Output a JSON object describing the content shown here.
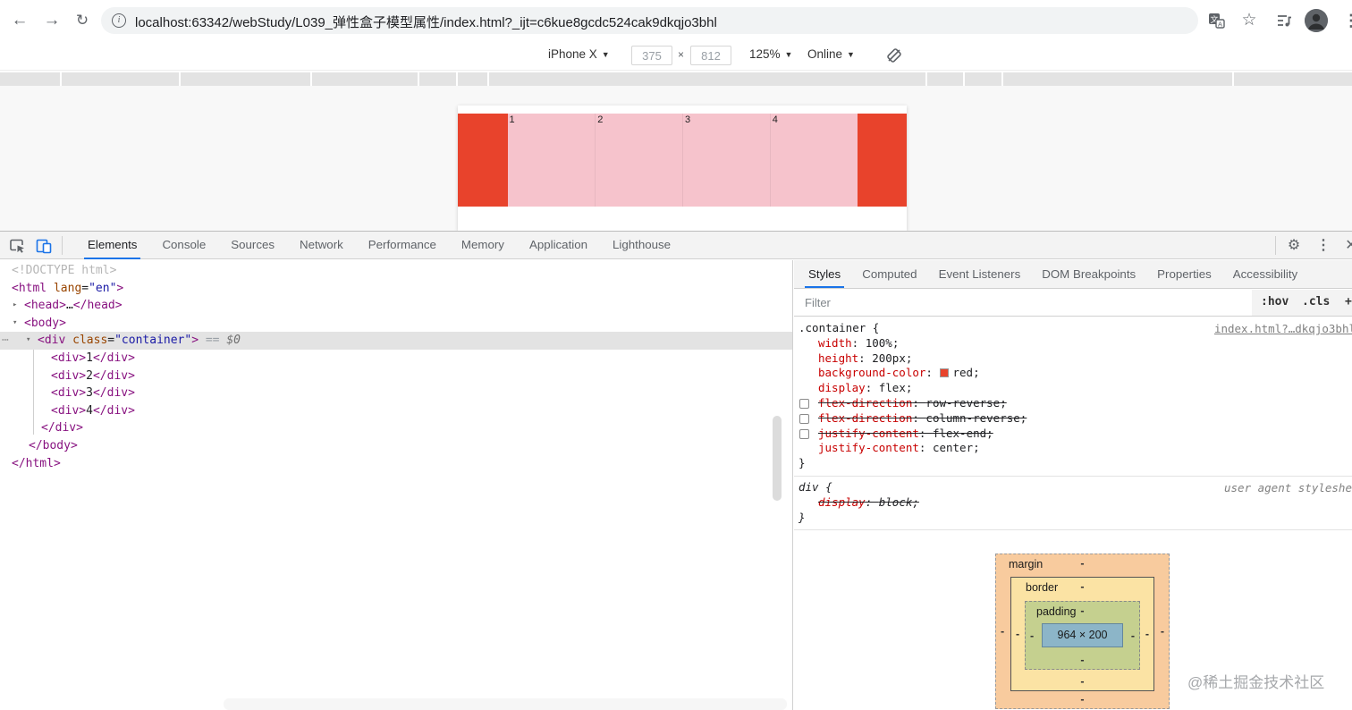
{
  "browser": {
    "url": "localhost:63342/webStudy/L039_弹性盒子模型属性/index.html?_ijt=c6kue8gcdc524cak9dkqjo3bhl"
  },
  "device_toolbar": {
    "device": "iPhone X",
    "width": "375",
    "height": "812",
    "times_label": "×",
    "zoom": "125%",
    "network": "Online"
  },
  "preview": {
    "container_color": "#e8432c",
    "item_color": "#f6c3cc",
    "items": [
      {
        "label": "1"
      },
      {
        "label": "2"
      },
      {
        "label": "3"
      },
      {
        "label": "4"
      }
    ]
  },
  "devtools": {
    "tabs": [
      {
        "label": "Elements",
        "active": true
      },
      {
        "label": "Console",
        "active": false
      },
      {
        "label": "Sources",
        "active": false
      },
      {
        "label": "Network",
        "active": false
      },
      {
        "label": "Performance",
        "active": false
      },
      {
        "label": "Memory",
        "active": false
      },
      {
        "label": "Application",
        "active": false
      },
      {
        "label": "Lighthouse",
        "active": false
      }
    ],
    "elements_tree": {
      "rows": [
        {
          "indent": 13,
          "tokens": [
            [
              "gray",
              "<!DOCTYPE html>"
            ]
          ]
        },
        {
          "indent": 13,
          "tokens": [
            [
              "tag",
              "<html"
            ],
            [
              "plain",
              " "
            ],
            [
              "attr",
              "lang"
            ],
            [
              "plain",
              "="
            ],
            [
              "val",
              "\"en\""
            ],
            [
              "tag",
              ">"
            ]
          ]
        },
        {
          "indent": 27,
          "arrow": "▸",
          "tokens": [
            [
              "tag",
              "<head>"
            ],
            [
              "plain",
              "…"
            ],
            [
              "tag",
              "</head>"
            ]
          ]
        },
        {
          "indent": 27,
          "arrow": "▾",
          "tokens": [
            [
              "tag",
              "<body>"
            ]
          ]
        },
        {
          "indent": 42,
          "arrow": "▾",
          "selected": true,
          "dots": "⋯",
          "tokens": [
            [
              "tag",
              "<div"
            ],
            [
              "plain",
              " "
            ],
            [
              "attr",
              "class"
            ],
            [
              "plain",
              "="
            ],
            [
              "val",
              "\"container\""
            ],
            [
              "tag",
              ">"
            ],
            [
              "eq",
              " == "
            ],
            [
              "dollar",
              "$0"
            ]
          ]
        },
        {
          "indent": 57,
          "tokens": [
            [
              "tag",
              "<div>"
            ],
            [
              "plain",
              "1"
            ],
            [
              "tag",
              "</div>"
            ]
          ]
        },
        {
          "indent": 57,
          "tokens": [
            [
              "tag",
              "<div>"
            ],
            [
              "plain",
              "2"
            ],
            [
              "tag",
              "</div>"
            ]
          ]
        },
        {
          "indent": 57,
          "tokens": [
            [
              "tag",
              "<div>"
            ],
            [
              "plain",
              "3"
            ],
            [
              "tag",
              "</div>"
            ]
          ]
        },
        {
          "indent": 57,
          "tokens": [
            [
              "tag",
              "<div>"
            ],
            [
              "plain",
              "4"
            ],
            [
              "tag",
              "</div>"
            ]
          ]
        },
        {
          "indent": 46,
          "tokens": [
            [
              "tag",
              "</div>"
            ]
          ]
        },
        {
          "indent": 32,
          "tokens": [
            [
              "tag",
              "</body>"
            ]
          ]
        },
        {
          "indent": 13,
          "tokens": [
            [
              "tag",
              "</html>"
            ]
          ]
        }
      ]
    },
    "sidebar": {
      "tabs": [
        {
          "label": "Styles",
          "active": true
        },
        {
          "label": "Computed",
          "active": false
        },
        {
          "label": "Event Listeners",
          "active": false
        },
        {
          "label": "DOM Breakpoints",
          "active": false
        },
        {
          "label": "Properties",
          "active": false
        },
        {
          "label": "Accessibility",
          "active": false
        }
      ],
      "filter_placeholder": "Filter",
      "hov": ":hov",
      "cls": ".cls",
      "plus": "+",
      "rules": [
        {
          "selector_line": ".container {",
          "source": "index.html?…dkqjo3bhl",
          "close": "}",
          "declarations": [
            {
              "prop": "width",
              "value": "100%"
            },
            {
              "prop": "height",
              "value": "200px"
            },
            {
              "prop": "background-color",
              "value": "red",
              "swatch": "#e8432c"
            },
            {
              "prop": "display",
              "value": "flex"
            },
            {
              "prop": "flex-direction",
              "value": "row-reverse",
              "disabled": true
            },
            {
              "prop": "flex-direction",
              "value": "column-reverse",
              "disabled": true
            },
            {
              "prop": "justify-content",
              "value": "flex-end",
              "disabled": true
            },
            {
              "prop": "justify-content",
              "value": "center"
            }
          ]
        },
        {
          "selector_line": "div {",
          "source": "user agent stylesheet",
          "source_clip": true,
          "ua": true,
          "close": "}",
          "declarations": [
            {
              "prop": "display",
              "value": "block",
              "disabled": true,
              "no_checkbox": true
            }
          ]
        }
      ]
    }
  },
  "box_model": {
    "margin_label": "margin",
    "border_label": "border",
    "padding_label": "padding",
    "content": "964 × 200",
    "dash": "-"
  },
  "watermark": "@稀土掘金技术社区"
}
